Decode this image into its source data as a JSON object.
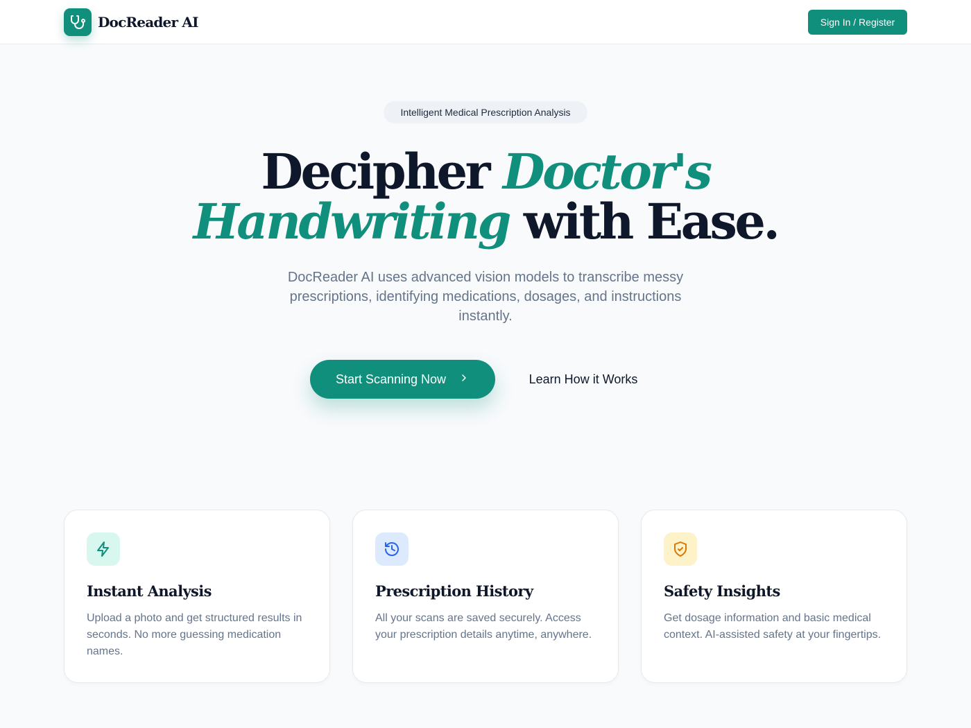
{
  "header": {
    "brand": "DocReader AI",
    "logo_icon": "stethoscope-icon",
    "signin_label": "Sign In / Register"
  },
  "hero": {
    "pill_text": "Intelligent Medical Prescription Analysis",
    "headline": {
      "part1": "Decipher",
      "part2": "Doctor's",
      "part3": "Handwriting",
      "part4": "with Ease."
    },
    "subtitle": "DocReader AI uses advanced vision models to transcribe messy prescriptions, identifying medications, dosages, and instructions instantly.",
    "primary_cta": "Start Scanning Now",
    "primary_cta_icon": "chevron-right-icon",
    "secondary_cta": "Learn How it Works"
  },
  "features": [
    {
      "icon": "lightning-icon",
      "title": "Instant Analysis",
      "description": "Upload a photo and get structured results in seconds. No more guessing medication names.",
      "icon_color": "#0f8f7c",
      "icon_bg": "#d8f7ee"
    },
    {
      "icon": "history-icon",
      "title": "Prescription History",
      "description": "All your scans are saved securely. Access your prescription details anytime, anywhere.",
      "icon_color": "#2563eb",
      "icon_bg": "#dde9fd"
    },
    {
      "icon": "shield-check-icon",
      "title": "Safety Insights",
      "description": "Get dosage information and basic medical context. AI-assisted safety at your fingertips.",
      "icon_color": "#d97706",
      "icon_bg": "#fdf2c8"
    }
  ],
  "colors": {
    "accent": "#0f8f7c",
    "text": "#0f172a",
    "muted": "#64748b",
    "background": "#f8fafc"
  }
}
